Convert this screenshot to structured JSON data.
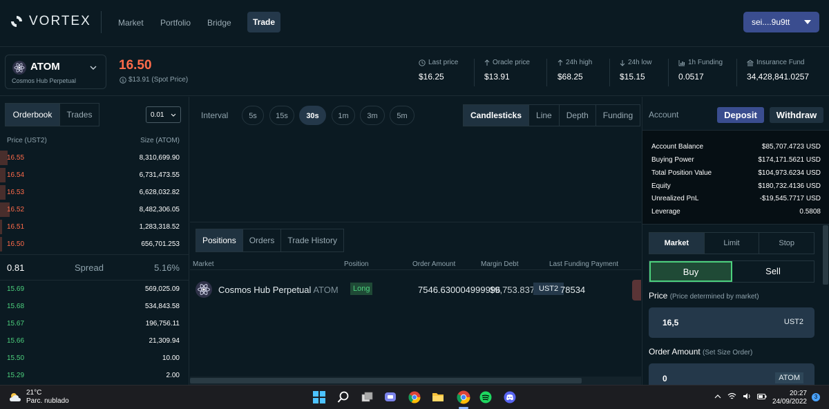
{
  "brand": {
    "name": "VORTEX"
  },
  "nav": {
    "items": [
      "Market",
      "Portfolio",
      "Bridge",
      "Trade"
    ],
    "active": "Trade"
  },
  "wallet": {
    "address": "sei....9u9tt"
  },
  "market": {
    "symbol": "ATOM",
    "name": "Cosmos Hub Perpetual",
    "price": "16.50",
    "spot_price": "$13.91 (Spot Price)",
    "stats": [
      {
        "label": "Last price",
        "value": "$16.25",
        "icon": "clock-icon"
      },
      {
        "label": "Oracle price",
        "value": "$13.91",
        "icon": "arrow-up-icon"
      },
      {
        "label": "24h high",
        "value": "$68.25",
        "icon": "arrow-up-icon"
      },
      {
        "label": "24h low",
        "value": "$15.15",
        "icon": "arrow-down-icon"
      },
      {
        "label": "1h Funding",
        "value": "0.0517",
        "icon": "bar-chart-icon"
      },
      {
        "label": "Insurance Fund",
        "value": "34,428,841.0257",
        "icon": "bank-icon"
      }
    ]
  },
  "orderbook": {
    "tabs": [
      "Orderbook",
      "Trades"
    ],
    "active_tab": "Orderbook",
    "tick": "0.01",
    "col_price": "Price (UST2)",
    "col_size": "Size (ATOM)",
    "asks": [
      {
        "price": "16.55",
        "size": "8,310,699.90",
        "depth": 0.04
      },
      {
        "price": "16.54",
        "size": "6,731,473.55",
        "depth": 0.03
      },
      {
        "price": "16.53",
        "size": "6,628,032.82",
        "depth": 0.03
      },
      {
        "price": "16.52",
        "size": "8,482,306.05",
        "depth": 0.05
      },
      {
        "price": "16.51",
        "size": "1,283,318.52",
        "depth": 0.01
      },
      {
        "price": "16.50",
        "size": "656,701.253",
        "depth": 0.01
      }
    ],
    "spread": {
      "last": "0.81",
      "label": "Spread",
      "pct": "5.16%"
    },
    "bids": [
      {
        "price": "15.69",
        "size": "569,025.09"
      },
      {
        "price": "15.68",
        "size": "534,843.58"
      },
      {
        "price": "15.67",
        "size": "196,756.11"
      },
      {
        "price": "15.66",
        "size": "21,309.94"
      },
      {
        "price": "15.50",
        "size": "10.00"
      },
      {
        "price": "15.29",
        "size": "2.00"
      }
    ]
  },
  "chart": {
    "interval_label": "Interval",
    "intervals": [
      "5s",
      "15s",
      "30s",
      "1m",
      "3m",
      "5m"
    ],
    "active_interval": "30s",
    "types": [
      "Candlesticks",
      "Line",
      "Depth",
      "Funding"
    ],
    "active_type": "Candlesticks"
  },
  "positions": {
    "tabs": [
      "Positions",
      "Orders",
      "Trade History"
    ],
    "active_tab": "Positions",
    "columns": [
      "Market",
      "Position",
      "Order Amount",
      "Margin Debt",
      "Last Funding Payment"
    ],
    "row": {
      "market": "Cosmos Hub Perpetual",
      "symbol": "ATOM",
      "side": "Long",
      "order_amount": "7546.630004999996",
      "margin_debt_overlap": "$9,753.837",
      "unit": "UST2",
      "debt_text": "$9,553.73",
      "funding": "78534"
    }
  },
  "account": {
    "title": "Account",
    "deposit": "Deposit",
    "withdraw": "Withdraw",
    "rows": [
      {
        "label": "Account Balance",
        "value": "$85,707.4723 USD"
      },
      {
        "label": "Buying Power",
        "value": "$174,171.5621 USD"
      },
      {
        "label": "Total Position Value",
        "value": "$104,973.6234 USD"
      },
      {
        "label": "Equity",
        "value": "$180,732.4136 USD"
      },
      {
        "label": "Unrealized PnL",
        "value": "-$19,545.7717 USD"
      },
      {
        "label": "Leverage",
        "value": "0.5808"
      }
    ]
  },
  "order_form": {
    "types": [
      "Market",
      "Limit",
      "Stop"
    ],
    "active_type": "Market",
    "buy": "Buy",
    "sell": "Sell",
    "price_label": "Price",
    "price_hint": "(Price determined by market)",
    "price_value": "16,5",
    "price_unit": "UST2",
    "amount_label": "Order Amount",
    "amount_hint": "(Set Size Order)",
    "amount_value": "0",
    "amount_unit": "ATOM"
  },
  "taskbar": {
    "temp": "21°C",
    "weather": "Parc. nublado",
    "time": "20:27",
    "date": "24/09/2022",
    "notifications": "3"
  }
}
